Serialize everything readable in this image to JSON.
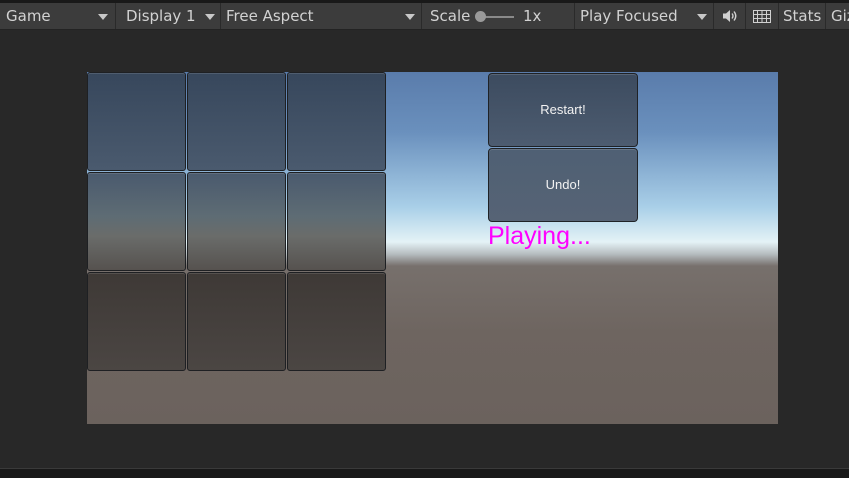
{
  "toolbar": {
    "view_tab": "Game",
    "display": "Display 1",
    "aspect": "Free Aspect",
    "scale_label": "Scale",
    "scale_value": "1x",
    "play_mode": "Play Focused",
    "stats_label": "Stats",
    "gizmos_label": "Gizmos"
  },
  "game": {
    "restart_label": "Restart!",
    "undo_label": "Undo!",
    "status_text": "Playing...",
    "status_color": "#ff00ff",
    "grid_rows": 3,
    "grid_cols": 3
  },
  "icons": {
    "audio": "speaker-icon",
    "stats_grid": "keyboard-grid-icon"
  }
}
